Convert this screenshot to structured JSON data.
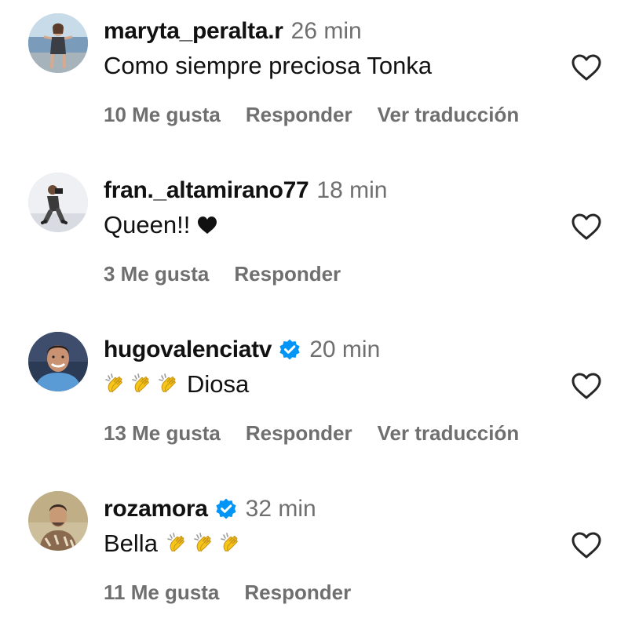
{
  "comments": [
    {
      "username": "maryta_peralta.r",
      "verified": false,
      "time": "26 min",
      "text": "Como siempre preciosa Tonka",
      "likes": "10 Me gusta",
      "reply": "Responder",
      "translate": "Ver traducción",
      "avatar": "woman-by-lake-avatar"
    },
    {
      "username": "fran._altamirano77",
      "verified": false,
      "time": "18 min",
      "text": "Queen!!",
      "text_suffix_icon": "black-heart-icon",
      "likes": "3 Me gusta",
      "reply": "Responder",
      "avatar": "photographer-crouching-avatar"
    },
    {
      "username": "hugovalenciatv",
      "verified": true,
      "time": "20 min",
      "text_prefix_icons": [
        "clapping-hands-emoji",
        "clapping-hands-emoji",
        "clapping-hands-emoji"
      ],
      "text": "Diosa",
      "likes": "13 Me gusta",
      "reply": "Responder",
      "translate": "Ver traducción",
      "avatar": "smiling-man-avatar"
    },
    {
      "username": "rozamora",
      "verified": true,
      "time": "32 min",
      "text": "Bella",
      "text_suffix_icons": [
        "clapping-hands-emoji",
        "clapping-hands-emoji",
        "clapping-hands-emoji"
      ],
      "likes": "11 Me gusta",
      "reply": "Responder",
      "avatar": "man-patterned-shirt-avatar"
    }
  ],
  "colors": {
    "meta_text": "#6f6f6f",
    "verified_blue": "#0095f6",
    "clap_yellow": "#f5c518"
  }
}
